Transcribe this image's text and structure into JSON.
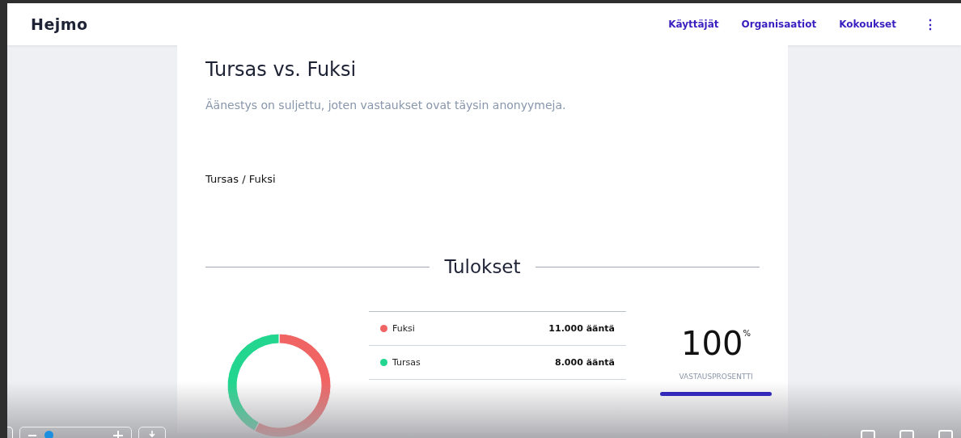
{
  "header": {
    "logo": "Hejmo",
    "nav": [
      {
        "label": "Käyttäjät"
      },
      {
        "label": "Organisaatiot"
      },
      {
        "label": "Kokoukset"
      }
    ],
    "menu_icon": "⋮"
  },
  "poll": {
    "title": "Tursas vs. Fuksi",
    "notice": "Äänestys on suljettu, joten vastaukset ovat täysin anonyymeja.",
    "question": "Tursas / Fuksi"
  },
  "results": {
    "heading": "Tulokset",
    "chart_data": {
      "type": "donut",
      "categories": [
        "Fuksi",
        "Tursas"
      ],
      "values": [
        57.9,
        42.1
      ]
    },
    "options": [
      {
        "votes": "11.000 ääntä",
        "color": "#f06464"
      },
      {
        "votes": "8.000 ääntä",
        "color": "#22d68f"
      }
    ],
    "response": {
      "value": "100",
      "unit": "%",
      "label": "VASTAUSPROSENTTI",
      "level": 1
    }
  }
}
